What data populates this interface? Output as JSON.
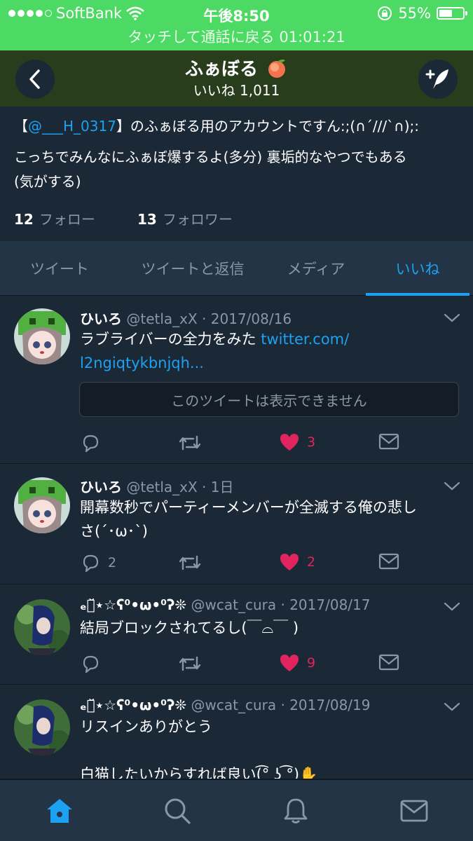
{
  "status": {
    "carrier": "SoftBank",
    "time": "午後8:50",
    "battery": "55%",
    "battery_level": 0.55
  },
  "call_bar": "タッチして通話に戻る 01:01:21",
  "nav": {
    "title": "ふぁぼる",
    "subtitle": "いいね 1,011"
  },
  "profile": {
    "bio_prefix": "【",
    "bio_mention": "@___H_0317",
    "bio_line1_rest": "】のふぁぼる用のアカウントですん:;(∩´///`∩);:",
    "bio_line2": "こっちでみんなにふぁぼ爆するよ(多分) 裏垢的なやつでもある",
    "bio_line3": "(気がする)",
    "following_count": "12",
    "following_label": "フォロー",
    "followers_count": "13",
    "followers_label": "フォロワー"
  },
  "tabs": [
    "ツイート",
    "ツイートと返信",
    "メディア",
    "いいね"
  ],
  "tweets": [
    {
      "name": "ひいろ",
      "meta": "@tetla_xX · 2017/08/16",
      "text1": "ラブライバーの全力をみた ",
      "link1": "twitter.com/",
      "link2": "l2ngiqtykbnjqh...",
      "unavailable": "このツイートは表示できません",
      "likes": "3"
    },
    {
      "name": "ひいろ",
      "meta": "@tetla_xX · 1日",
      "text1": "開幕数秒でパーティーメンバーが全滅する俺の悲し",
      "text2": "さ(´･ω･`)",
      "replies": "2",
      "likes": "2"
    },
    {
      "name": "ₑゅ̆⋆☆ʕ⁰•ω•⁰ʔ❊",
      "meta": "@wcat_cura · 2017/08/17",
      "text1": "結局ブロックされてるし(￣⌓￣ )",
      "likes": "9"
    },
    {
      "name": "ₑゅ̆⋆☆ʕ⁰•ω•⁰ʔ❊",
      "meta": "@wcat_cura · 2017/08/19",
      "text1": "リスインありがとう",
      "text2": "白猫したいからすれば良い(͡° ͜ʖ ͡°)✋"
    }
  ],
  "icons": {
    "back": "back-chevron-icon",
    "compose": "compose-feather-icon",
    "reply": "reply-icon",
    "retweet": "retweet-icon",
    "like": "heart-icon",
    "dm": "envelope-icon",
    "home": "home-icon",
    "search": "search-icon",
    "notifications": "bell-icon",
    "messages": "envelope-icon"
  },
  "colors": {
    "accent": "#1da1f2",
    "like": "#e0245e",
    "call_bar": "#4cd964",
    "background": "#1b2836"
  }
}
